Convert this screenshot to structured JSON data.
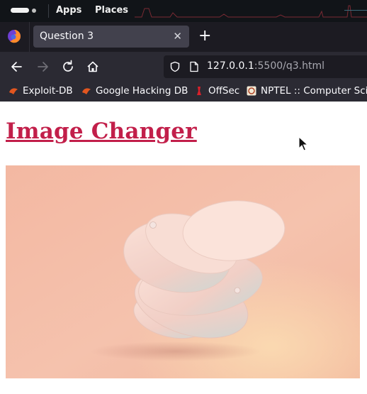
{
  "panel": {
    "apps": "Apps",
    "places": "Places"
  },
  "tabs": [
    {
      "title": "Question 3"
    }
  ],
  "navbar": {
    "url_host": "127.0.0.1",
    "url_path": ":5500/q3.html"
  },
  "bookmarks": [
    {
      "label": "Exploit-DB",
      "icon": "exploit-db-icon"
    },
    {
      "label": "Google Hacking DB",
      "icon": "ghdb-icon"
    },
    {
      "label": "OffSec",
      "icon": "offsec-icon"
    },
    {
      "label": "NPTEL :: Computer Sci...",
      "icon": "nptel-icon"
    }
  ],
  "page": {
    "heading": "Image Changer"
  },
  "colors": {
    "heading": "#c21f4a",
    "tab_active": "#42414d",
    "toolbar": "#2b2a33"
  }
}
